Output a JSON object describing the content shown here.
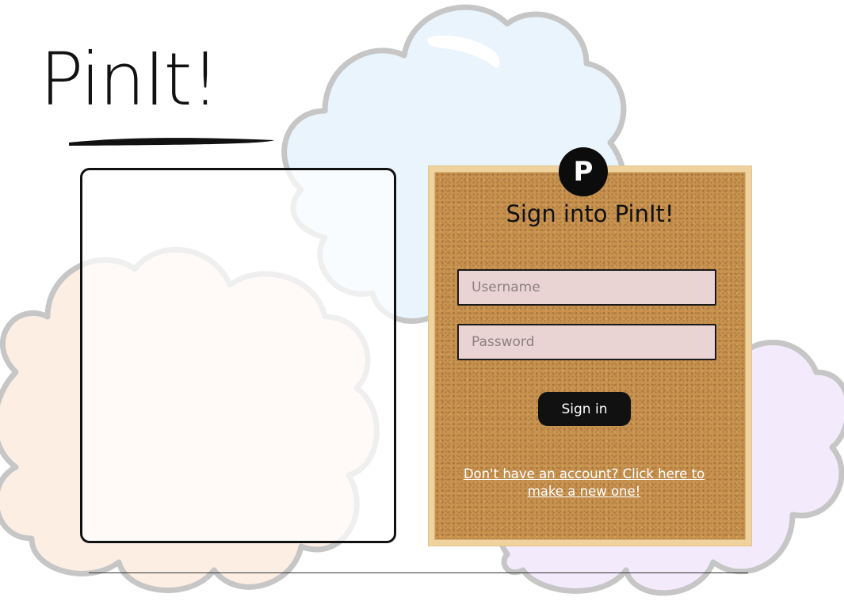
{
  "brand": {
    "title": "PinIt!",
    "badge_letter": "P"
  },
  "signin": {
    "heading": "Sign into PinIt!",
    "username_placeholder": "Username",
    "password_placeholder": "Password",
    "button_label": "Sign in",
    "register_link": "Don't have an account? Click here to make a new one!"
  },
  "colors": {
    "cork": "#c8924f",
    "frame": "#efd29e",
    "input_fill": "#e9d3d3",
    "button": "#111111",
    "cloud_blue": "#eaf4fd",
    "cloud_peach": "#fdeee4",
    "cloud_lavender": "#f3eafb",
    "cloud_outline": "#c6c6c6"
  }
}
